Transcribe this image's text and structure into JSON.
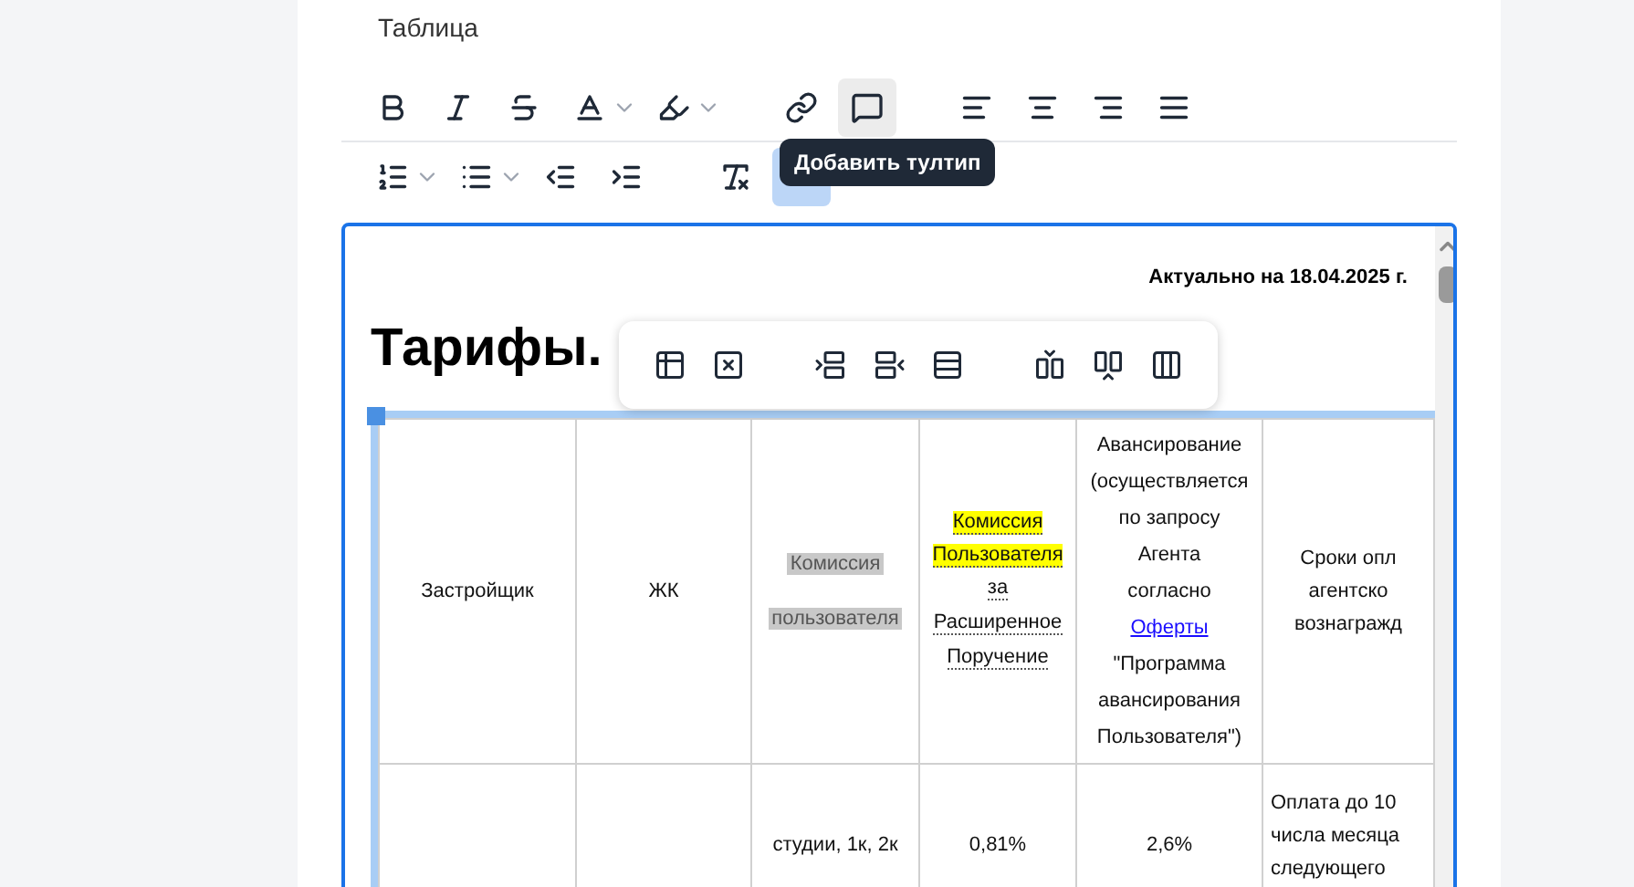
{
  "field_label": "Таблица",
  "toolbar_rows": [
    [
      {
        "kind": "bold",
        "active": false
      },
      {
        "kind": "italic",
        "active": false
      },
      {
        "kind": "strike",
        "active": false
      },
      {
        "kind": "text_color",
        "active": false
      },
      {
        "kind": "highlight",
        "active": false
      },
      {
        "kind": "gap"
      },
      {
        "kind": "link",
        "active": false
      },
      {
        "kind": "comment",
        "active": true
      },
      {
        "kind": "gap"
      },
      {
        "kind": "align_left",
        "active": false
      },
      {
        "kind": "align_center",
        "active": false
      },
      {
        "kind": "align_right",
        "active": false
      },
      {
        "kind": "align_justify",
        "active": false
      }
    ],
    [
      {
        "kind": "ordered_list",
        "active": false
      },
      {
        "kind": "bullet_list",
        "active": false
      },
      {
        "kind": "outdent",
        "active": false
      },
      {
        "kind": "indent",
        "active": false
      },
      {
        "kind": "gap"
      },
      {
        "kind": "clear_format",
        "active": false
      },
      {
        "kind": "blank",
        "active": true
      }
    ]
  ],
  "tooltip": "Добавить тултип",
  "document": {
    "date_note": "Актуально на 18.04.2025 г.",
    "heading": "Тарифы.",
    "table_tools": [
      {
        "kind": "table"
      },
      {
        "kind": "delete_table"
      },
      {
        "kind": "gap"
      },
      {
        "kind": "row_before"
      },
      {
        "kind": "row_after"
      },
      {
        "kind": "delete_row"
      },
      {
        "kind": "gap"
      },
      {
        "kind": "col_before"
      },
      {
        "kind": "col_after"
      },
      {
        "kind": "delete_col"
      }
    ],
    "header_row": [
      {
        "kind": "plain",
        "lines": [
          "Застройщик"
        ]
      },
      {
        "kind": "plain",
        "lines": [
          "ЖК"
        ]
      },
      {
        "kind": "gray",
        "lines": [
          "Комиссия",
          "пользователя"
        ]
      },
      {
        "kind": "yellow",
        "lines": [
          "Комиссия",
          "Пользователя"
        ],
        "rest": [
          "за",
          "Расширенное",
          "Поручение"
        ]
      },
      {
        "kind": "link",
        "before": [
          "Авансирование",
          "(осуществляется",
          "по запросу",
          "Агента",
          "согласно"
        ],
        "link": "Оферты",
        "after": [
          "\"Программа",
          "авансирования",
          "Пользователя\")"
        ]
      },
      {
        "kind": "plain",
        "lines": [
          "Сроки опл",
          "агентско",
          "вознагражд"
        ]
      }
    ],
    "data_row": [
      {
        "kind": "plain"
      },
      {
        "kind": "plain"
      },
      {
        "kind": "plain",
        "lines": [
          "студии, 1к, 2к"
        ]
      },
      {
        "kind": "plain",
        "lines": [
          "0,81%"
        ]
      },
      {
        "kind": "plain",
        "lines": [
          "2,6%"
        ]
      },
      {
        "kind": "top",
        "lines": [
          "Оплата до 10",
          "числа месяца",
          "следующего"
        ]
      }
    ]
  }
}
